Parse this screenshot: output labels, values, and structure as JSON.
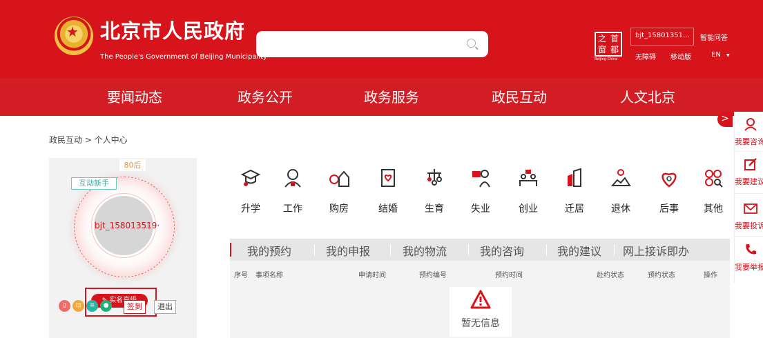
{
  "header": {
    "site_title": "北京市人民政府",
    "site_subtitle": "The People's Government of Beijing Municipality",
    "search_placeholder": "",
    "shoudu_chars": [
      "之",
      "首",
      "窗",
      "都"
    ],
    "shoudu_en": "Beijing-China",
    "username": "bjt_15801351...",
    "smart_qa": "智能问答",
    "accessibility": "无障碍",
    "mobile": "移动版",
    "language": "EN",
    "language_caret": "▼",
    "brand_color": "#d7141b"
  },
  "nav": {
    "items": [
      "要闻动态",
      "政务公开",
      "政务服务",
      "政民互动",
      "人文北京"
    ]
  },
  "breadcrumb": "政民互动 > 个人中心",
  "profile": {
    "age_tag": "80后",
    "level_tag": "互动新手",
    "name": "bjt_158013519·",
    "verify_label": "实名高级",
    "verify_icon": "edit-icon",
    "status_icons": [
      "phone-icon",
      "lock-icon",
      "database-icon",
      "user-icon"
    ],
    "sign_in": "签到",
    "logout": "退出"
  },
  "categories": [
    {
      "label": "升学",
      "icon": "graduation-cap-icon"
    },
    {
      "label": "工作",
      "icon": "worker-icon"
    },
    {
      "label": "购房",
      "icon": "house-icon"
    },
    {
      "label": "结婚",
      "icon": "marriage-book-icon"
    },
    {
      "label": "生育",
      "icon": "baby-mobile-icon"
    },
    {
      "label": "失业",
      "icon": "unemployment-icon"
    },
    {
      "label": "创业",
      "icon": "startup-icon"
    },
    {
      "label": "迁居",
      "icon": "building-icon"
    },
    {
      "label": "退休",
      "icon": "retirement-icon"
    },
    {
      "label": "后事",
      "icon": "heart-icon"
    },
    {
      "label": "其他",
      "icon": "other-icon"
    }
  ],
  "tabs": [
    "我的预约",
    "我的申报",
    "我的物流",
    "我的咨询",
    "我的建议",
    "网上接诉即办"
  ],
  "table": {
    "headers": [
      "序号",
      "事项名称",
      "申请时间",
      "预约编号",
      "预约时间",
      "赴约状态",
      "预约状态",
      "操作"
    ],
    "empty_text": "暂无信息"
  },
  "sidebar": {
    "toggle": ">",
    "items": [
      {
        "label": "我要咨询",
        "icon": "consult-icon"
      },
      {
        "label": "我要建议",
        "icon": "suggest-icon"
      },
      {
        "label": "我要投诉",
        "icon": "mail-icon"
      },
      {
        "label": "我要举报",
        "icon": "phone-report-icon"
      }
    ]
  }
}
